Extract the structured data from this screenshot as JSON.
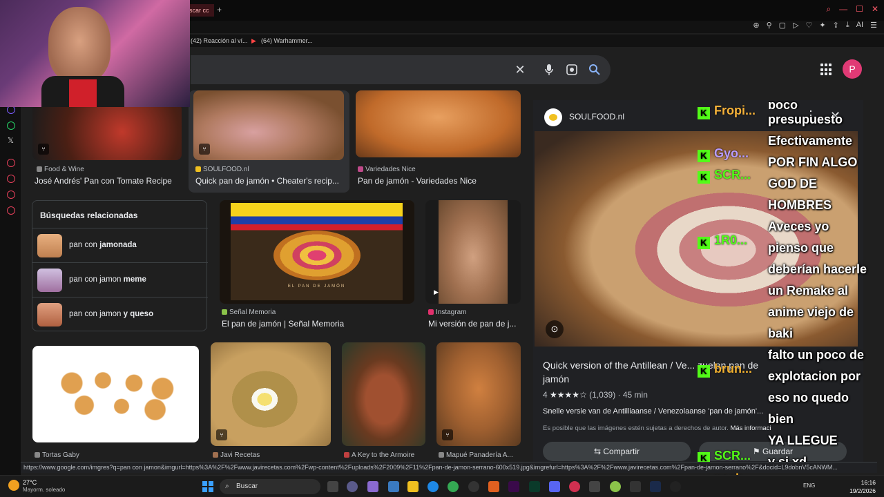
{
  "browser": {
    "tab_title": "scar cc",
    "bookmarks": [
      "(42) Reacción al ví...",
      "(64) Warhammer..."
    ]
  },
  "search": {
    "clear_icon": "close-icon",
    "mic_icon": "mic-icon",
    "lens_icon": "lens-icon",
    "search_icon": "search-icon",
    "avatar_letter": "P"
  },
  "results": {
    "row1": [
      {
        "source": "Food & Wine",
        "title": "José Andrés' Pan con Tomate Recipe",
        "color": "#7a3a2a"
      },
      {
        "source": "SOULFOOD.nl",
        "title": "Quick pan de jamón • Cheater's recip...",
        "color": "#c79a6a"
      },
      {
        "source": "Variedades Nice",
        "title": "Pan de jamón - Variedades Nice",
        "color": "#d98a3a"
      }
    ],
    "related": {
      "title": "Búsquedas relacionadas",
      "items": [
        {
          "prefix": "pan con ",
          "bold": "jamonada"
        },
        {
          "prefix": "pan con jamon ",
          "bold": "meme"
        },
        {
          "prefix": "pan con jamon ",
          "bold": "y queso"
        }
      ]
    },
    "row2": [
      {
        "source": "Señal Memoria",
        "title": "El pan de jamón | Señal Memoria",
        "caption": "EL PAN DE JAMÓN"
      },
      {
        "source": "Instagram",
        "title": "Mi versión de pan de j..."
      }
    ],
    "row3": [
      {
        "source": "Tortas Gaby"
      },
      {
        "source": "Javi Recetas"
      },
      {
        "source": "A Key to the Armoire"
      },
      {
        "source": "Mapué Panadería A..."
      }
    ]
  },
  "panel": {
    "site": "SOULFOOD.nl",
    "title": "Quick version of the Antillean / Ve... zuelan pan de jamón",
    "rating": "4",
    "stars": "★★★★☆",
    "reviews": "(1,039)",
    "time": "45 min",
    "description": "Snelle versie van de Antilliaanse / Venezolaanse 'pan de jamón'...",
    "copyright": "Es posible que las imágenes estén sujetas a derechos de autor.",
    "more_info": "Más información",
    "share": "Compartir",
    "save": "Guardar"
  },
  "chat": {
    "lines": [
      "poco",
      "presupuesto",
      "Efectivamente",
      "POR FIN ALGO",
      "GOD DE",
      "HOMBRES",
      "Aveces yo",
      "pienso que",
      "deberían hacerle",
      "un Remake al",
      "anime viejo de",
      "baki",
      "falto un poco de",
      "explotacion por",
      "eso no quedo",
      "bien",
      "YA LLEGUE",
      "y si xd"
    ],
    "kick_users": [
      "Fropi...",
      "Gyo...",
      "SCR...",
      "1R0...",
      "brun...",
      "SCR...",
      "nach..."
    ]
  },
  "status_url": "https://www.google.com/imgres?q=pan con jamon&imgurl=https%3A%2F%2Fwww.javirecetas.com%2Fwp-content%2Fuploads%2F2009%2F11%2Fpan-de-jamon-serrano-600x519.jpg&imgrefurl=https%3A%2F%2Fwww.javirecetas.com%2Fpan-de-jamon-serrano%2F&docid=L9dobnV5cANWM...",
  "taskbar": {
    "weather_temp": "27°C",
    "weather_text": "Mayorm. soleado",
    "search": "Buscar",
    "lang": "ENG",
    "time": "16:16",
    "date": "19/2/2026"
  }
}
